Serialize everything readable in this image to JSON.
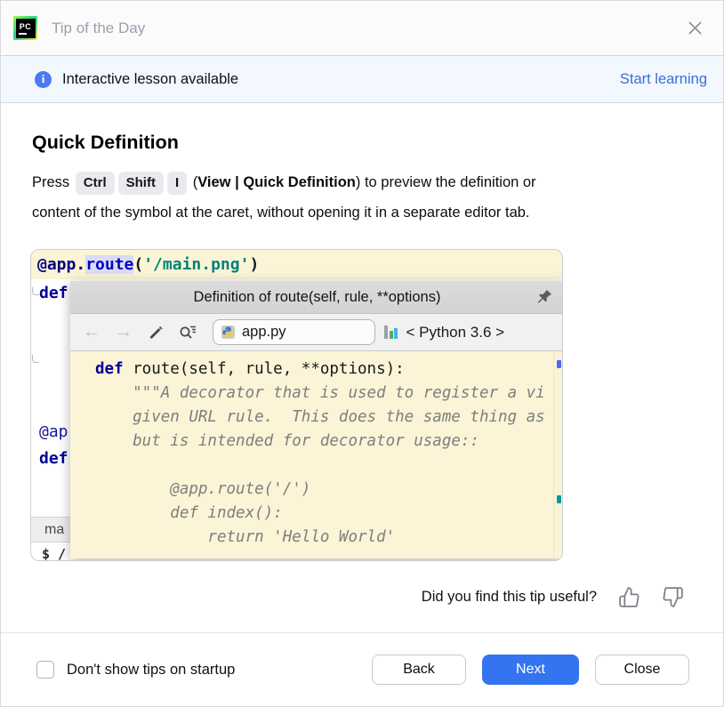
{
  "window": {
    "title": "Tip of the Day",
    "logo_text": "PC"
  },
  "banner": {
    "text": "Interactive lesson available",
    "link": "Start learning"
  },
  "tip": {
    "heading": "Quick Definition",
    "intro": {
      "press": "Press",
      "keys": [
        "Ctrl",
        "Shift",
        "I"
      ],
      "paren_open": "(",
      "menu1": "View",
      "sep": "|",
      "menu2": "Quick Definition",
      "rest1": ") to preview the definition or",
      "rest2": "content of the symbol at the caret, without opening it in a separate editor tab."
    }
  },
  "editor": {
    "line1": {
      "decorator": "@app.",
      "func": "route",
      "open": "(",
      "string": "'/main.png'",
      "close": ")"
    },
    "gutter_def1": "def",
    "gutter_at": "@ap",
    "gutter_def2": "def",
    "tab_label": "ma",
    "terminal": "$ /"
  },
  "popup": {
    "title": "Definition of route(self, rule, **options)",
    "file_name": "app.py",
    "interpreter": "< Python 3.6 >",
    "code": {
      "kw_def": "def",
      "signature": " route(self, rule, **options):",
      "doc_lines": [
        "    \"\"\"A decorator that is used to register a vi",
        "    given URL rule.  This does the same thing as",
        "    but is intended for decorator usage::",
        "",
        "        @app.route('/')",
        "        def index():",
        "            return 'Hello World'"
      ]
    }
  },
  "feedback": {
    "question": "Did you find this tip useful?"
  },
  "footer": {
    "checkbox_label": "Don't show tips on startup",
    "back": "Back",
    "next": "Next",
    "close": "Close"
  },
  "icons": {
    "close": "pycharm-close-x",
    "info": "info-circle",
    "pin": "pushpin",
    "back_arrow": "←",
    "forward_arrow": "→",
    "edit": "pencil",
    "find": "find-usages-magnifier",
    "python_file": "python-logo",
    "scope": "bar-chart",
    "thumbs_up": "thumbs-up-outline",
    "thumbs_down": "thumbs-down-outline"
  },
  "colors": {
    "accent_blue": "#3574F0",
    "link_blue": "#3B6FD6",
    "info_blue": "#4A7CF0",
    "banner_bg": "#F3F7FE",
    "popup_body_bg": "#FBF4D7",
    "keyword_blue": "#000096",
    "string_teal": "#00827A",
    "docstring_gray": "#7E7E7E",
    "selection_lavender": "#D9DCF6"
  }
}
